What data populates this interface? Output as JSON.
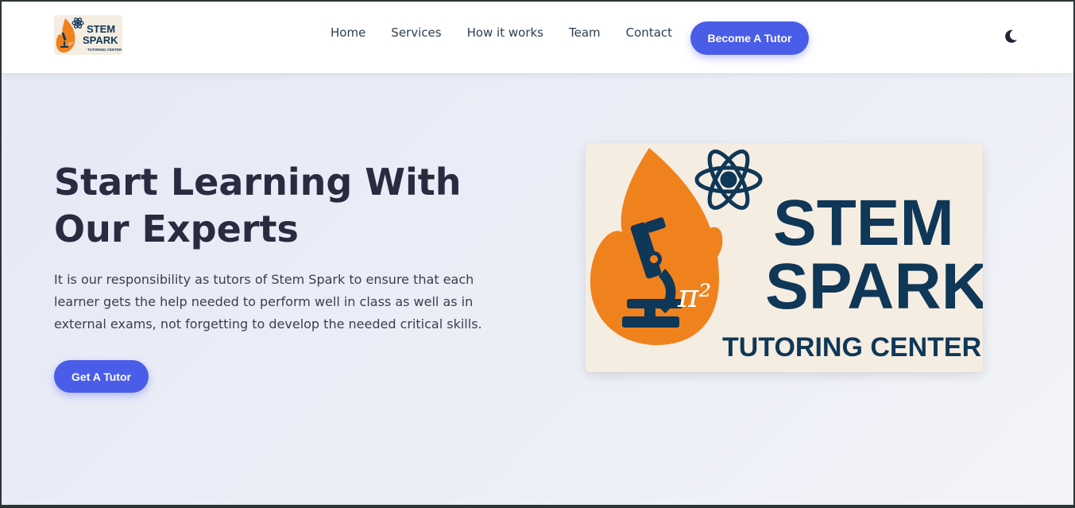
{
  "brand": {
    "logo_line1": "STEM",
    "logo_line2": "SPARK",
    "logo_line3": "TUTORING CENTER",
    "pi_symbol": "π²",
    "icons": [
      "flame-icon",
      "microscope-icon",
      "atom-icon"
    ],
    "colors": {
      "flame": "#f0821e",
      "navy": "#0f3757",
      "cream": "#f5ede2"
    }
  },
  "nav": {
    "links": [
      "Home",
      "Services",
      "How it works",
      "Team",
      "Contact"
    ],
    "cta": "Become A Tutor",
    "theme_toggle_icon": "moon-icon"
  },
  "hero": {
    "title": "Start Learning With Our Experts",
    "text": "It is our responsibility as tutors of Stem Spark to ensure that each learner gets the help needed to perform well in class as well as in external exams, not forgetting to develop the needed critical skills.",
    "cta": "Get A Tutor"
  },
  "colors": {
    "accent": "#4a5de8",
    "heading": "#2a2a40",
    "body_text": "#3a3f4a",
    "hero_bg": "#e9ebf6"
  }
}
